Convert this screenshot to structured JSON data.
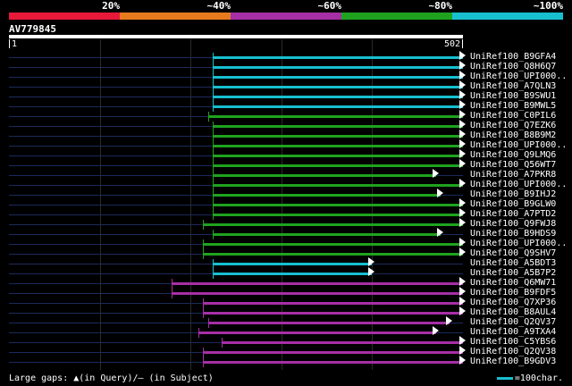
{
  "legend": {
    "labels": [
      "20%",
      "~40%",
      "~60%",
      "~80%",
      "~100%"
    ],
    "colors": [
      "#e8193a",
      "#e87a1e",
      "#a62fa6",
      "#1fa31f",
      "#17bfcf"
    ]
  },
  "query": {
    "id": "AV779845",
    "start": "1",
    "end": "502"
  },
  "hits": [
    {
      "name": "UniRef100_B9GFA4",
      "start": 45,
      "end": 100,
      "color": "#17bfcf"
    },
    {
      "name": "UniRef100_Q8H6Q7",
      "start": 45,
      "end": 100,
      "color": "#17bfcf"
    },
    {
      "name": "UniRef100_UPI000..",
      "start": 45,
      "end": 100,
      "color": "#17bfcf"
    },
    {
      "name": "UniRef100_A7QLN3",
      "start": 45,
      "end": 100,
      "color": "#17bfcf"
    },
    {
      "name": "UniRef100_B9SWU1",
      "start": 45,
      "end": 100,
      "color": "#17bfcf"
    },
    {
      "name": "UniRef100_B9MWL5",
      "start": 45,
      "end": 100,
      "color": "#17bfcf"
    },
    {
      "name": "UniRef100_C0PIL6",
      "start": 44,
      "end": 100,
      "color": "#1fa31f"
    },
    {
      "name": "UniRef100_Q7EZK6",
      "start": 45,
      "end": 100,
      "color": "#1fa31f"
    },
    {
      "name": "UniRef100_B8B9M2",
      "start": 45,
      "end": 100,
      "color": "#1fa31f"
    },
    {
      "name": "UniRef100_UPI000..",
      "start": 45,
      "end": 100,
      "color": "#1fa31f"
    },
    {
      "name": "UniRef100_Q9LMQ6",
      "start": 45,
      "end": 100,
      "color": "#1fa31f"
    },
    {
      "name": "UniRef100_Q56WT7",
      "start": 45,
      "end": 100,
      "color": "#1fa31f"
    },
    {
      "name": "UniRef100_A7PKR8",
      "start": 45,
      "end": 94,
      "color": "#1fa31f"
    },
    {
      "name": "UniRef100_UPI000..",
      "start": 45,
      "end": 100,
      "color": "#1fa31f"
    },
    {
      "name": "UniRef100_B9IHJ2",
      "start": 45,
      "end": 95,
      "color": "#1fa31f"
    },
    {
      "name": "UniRef100_B9GLW0",
      "start": 45,
      "end": 100,
      "color": "#1fa31f"
    },
    {
      "name": "UniRef100_A7PTD2",
      "start": 45,
      "end": 100,
      "color": "#1fa31f"
    },
    {
      "name": "UniRef100_Q9FWJ8",
      "start": 43,
      "end": 100,
      "color": "#1fa31f"
    },
    {
      "name": "UniRef100_B9HDS9",
      "start": 45,
      "end": 95,
      "color": "#1fa31f"
    },
    {
      "name": "UniRef100_UPI000..",
      "start": 43,
      "end": 100,
      "color": "#1fa31f"
    },
    {
      "name": "UniRef100_Q9SHV7",
      "start": 43,
      "end": 100,
      "color": "#1fa31f"
    },
    {
      "name": "UniRef100_A5BDT3",
      "start": 45,
      "end": 80,
      "color": "#17bfcf"
    },
    {
      "name": "UniRef100_A5B7P2",
      "start": 45,
      "end": 80,
      "color": "#17bfcf"
    },
    {
      "name": "UniRef100_Q6MW71",
      "start": 36,
      "end": 100,
      "color": "#a62fa6"
    },
    {
      "name": "UniRef100_B9FDF5",
      "start": 36,
      "end": 100,
      "color": "#a62fa6"
    },
    {
      "name": "UniRef100_Q7XP36",
      "start": 43,
      "end": 100,
      "color": "#a62fa6"
    },
    {
      "name": "UniRef100_B8AUL4",
      "start": 43,
      "end": 100,
      "color": "#a62fa6"
    },
    {
      "name": "UniRef100_Q2QV37",
      "start": 44,
      "end": 97,
      "color": "#a62fa6"
    },
    {
      "name": "UniRef100_A9TXA4",
      "start": 42,
      "end": 94,
      "color": "#a62fa6"
    },
    {
      "name": "UniRef100_C5YBS6",
      "start": 47,
      "end": 100,
      "color": "#a62fa6"
    },
    {
      "name": "UniRef100_Q2QV38",
      "start": 43,
      "end": 100,
      "color": "#a62fa6"
    },
    {
      "name": "UniRef100_B9GDV3",
      "start": 43,
      "end": 100,
      "color": "#a62fa6"
    }
  ],
  "footer": {
    "gaps_label": "Large gaps: ▲(in Query)/– (in Subject)",
    "scale_label": "=100char."
  }
}
